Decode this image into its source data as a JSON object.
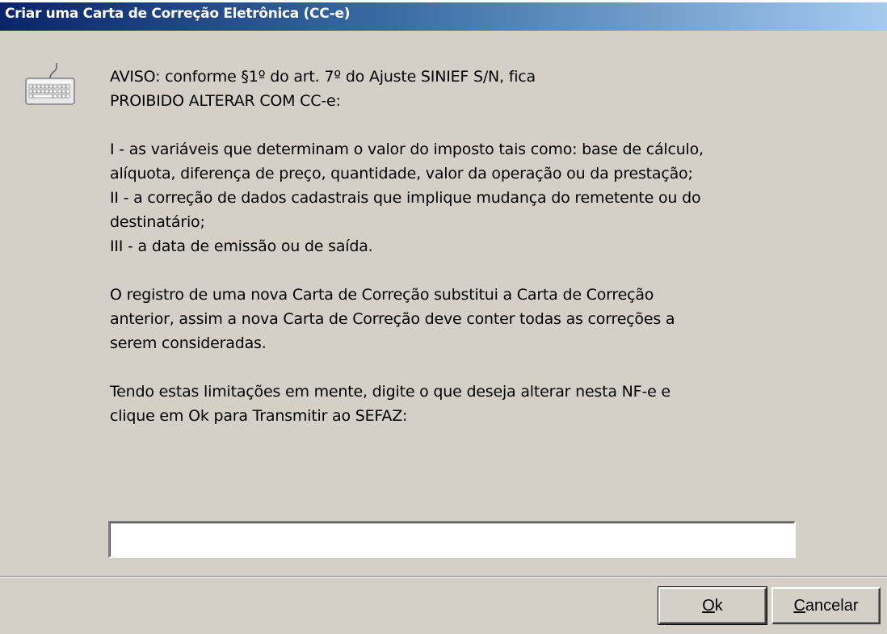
{
  "window": {
    "title": "Criar uma Carta de Correção Eletrônica (CC-e)"
  },
  "icon": "keyboard-icon",
  "message": {
    "lines": [
      "AVISO: conforme §1º do art. 7º do Ajuste SINIEF S/N, fica",
      "PROIBIDO ALTERAR COM CC-e:",
      "",
      "I - as variáveis que determinam o valor do imposto tais como: base de cálculo,",
      "alíquota, diferença de preço, quantidade, valor da operação ou da prestação;",
      "II - a correção de dados cadastrais que implique mudança do remetente ou do",
      "destinatário;",
      "III - a data de emissão ou de saída.",
      "",
      "O registro de uma nova Carta de Correção substitui a Carta de Correção",
      "anterior, assim a nova Carta de Correção deve conter todas as correções a",
      "serem consideradas.",
      "",
      "Tendo estas limitações em mente, digite o que deseja alterar nesta NF-e e",
      "clique em Ok para Transmitir ao SEFAZ:"
    ]
  },
  "correction_input": {
    "value": ""
  },
  "buttons": {
    "ok_mnemonic": "O",
    "ok_rest": "k",
    "cancel_mnemonic": "C",
    "cancel_rest": "ancelar"
  },
  "colors": {
    "face": "#d4d0c8",
    "title_start": "#0a246a",
    "title_end": "#a6caf0"
  }
}
